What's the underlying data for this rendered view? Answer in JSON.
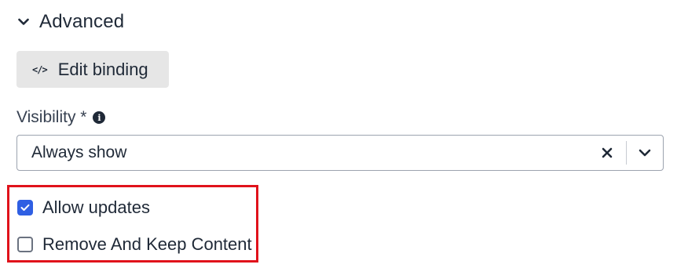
{
  "section": {
    "title": "Advanced",
    "expanded": true
  },
  "edit_binding": {
    "icon_text": "</>",
    "label": "Edit binding"
  },
  "visibility": {
    "label": "Visibility *",
    "info_glyph": "i",
    "selected": "Always show",
    "clear_glyph": "✕"
  },
  "options": [
    {
      "label": "Allow updates",
      "checked": true
    },
    {
      "label": "Remove And Keep Content",
      "checked": false
    }
  ],
  "colors": {
    "accent": "#2f5fe3",
    "highlight": "#e0121b",
    "button_bg": "#e6e6e6"
  }
}
